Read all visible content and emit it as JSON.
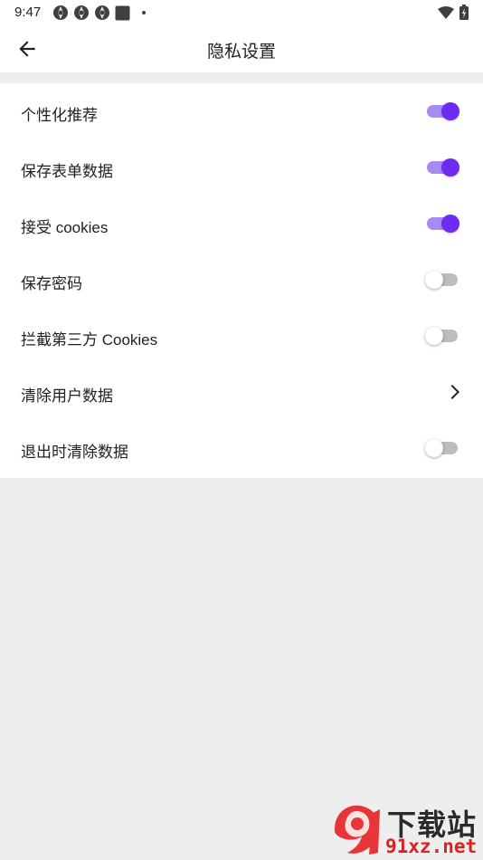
{
  "status_bar": {
    "time": "9:47"
  },
  "app_bar": {
    "title": "隐私设置"
  },
  "settings": [
    {
      "label": "个性化推荐",
      "control": "toggle",
      "state": "on"
    },
    {
      "label": "保存表单数据",
      "control": "toggle",
      "state": "on"
    },
    {
      "label": "接受 cookies",
      "control": "toggle",
      "state": "on"
    },
    {
      "label": "保存密码",
      "control": "toggle",
      "state": "off"
    },
    {
      "label": "拦截第三方 Cookies",
      "control": "toggle",
      "state": "off"
    },
    {
      "label": "清除用户数据",
      "control": "chevron"
    },
    {
      "label": "退出时清除数据",
      "control": "toggle",
      "state": "off"
    }
  ],
  "watermark": {
    "logo_text": "91",
    "title": "下载站",
    "subtitle": "91xz.net"
  },
  "colors": {
    "accent": "#6e2bf2",
    "accent_track": "#a58bf2",
    "off_track": "#bdbdbd",
    "background": "#eeeeee",
    "surface": "#ffffff"
  }
}
